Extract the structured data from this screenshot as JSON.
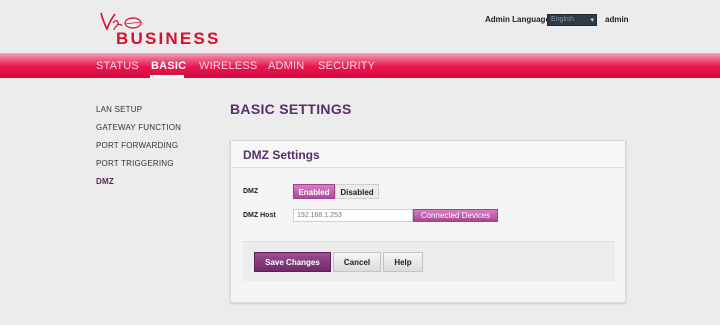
{
  "header": {
    "brand": "BUSINESS",
    "logo_script": "Virgin",
    "language_label": "Admin Language:",
    "language_value": "English",
    "user": "admin"
  },
  "nav": {
    "items": [
      {
        "label": "STATUS",
        "active": false
      },
      {
        "label": "BASIC",
        "active": true
      },
      {
        "label": "WIRELESS",
        "active": false
      },
      {
        "label": "ADMIN",
        "active": false
      },
      {
        "label": "SECURITY",
        "active": false
      }
    ]
  },
  "sidebar": {
    "items": [
      {
        "label": "LAN SETUP",
        "active": false
      },
      {
        "label": "GATEWAY FUNCTION",
        "active": false
      },
      {
        "label": "PORT FORWARDING",
        "active": false
      },
      {
        "label": "PORT TRIGGERING",
        "active": false
      },
      {
        "label": "DMZ",
        "active": true
      }
    ]
  },
  "main": {
    "title": "BASIC SETTINGS",
    "panel": {
      "title": "DMZ Settings",
      "dmz_label": "DMZ",
      "dmz_enabled_label": "Enabled",
      "dmz_disabled_label": "Disabled",
      "dmz_state": "Enabled",
      "host_label": "DMZ Host",
      "host_value": "192.168.1.253",
      "connected_devices_label": "Connected Devices"
    },
    "actions": {
      "save_label": "Save Changes",
      "cancel_label": "Cancel",
      "help_label": "Help"
    }
  },
  "colors": {
    "brand_red": "#d8102e",
    "nav_red": "#e8174e",
    "purple_accent": "#5a2d6b",
    "enabled_pink": "#b04aa0"
  }
}
